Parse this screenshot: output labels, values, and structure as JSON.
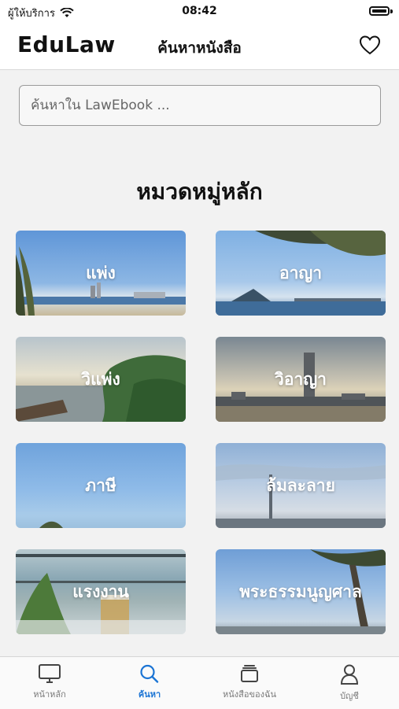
{
  "status_bar": {
    "carrier": "ผู้ให้บริการ",
    "time": "08:42"
  },
  "header": {
    "brand": "EduLaw",
    "title": "ค้นหาหนังสือ",
    "favorite_icon": "heart-icon"
  },
  "search": {
    "placeholder": "ค้นหาใน LawEbook ..."
  },
  "section_title": "หมวดหมู่หลัก",
  "categories": [
    {
      "label": "แพ่ง"
    },
    {
      "label": "อาญา"
    },
    {
      "label": "วิแพ่ง"
    },
    {
      "label": "วิอาญา"
    },
    {
      "label": "ภาษี"
    },
    {
      "label": "ล้มละลาย"
    },
    {
      "label": "แรงงาน"
    },
    {
      "label": "พระธรรมนูญศาล"
    }
  ],
  "tab_bar": {
    "items": [
      {
        "label": "หน้าหลัก",
        "icon": "monitor-icon",
        "active": false
      },
      {
        "label": "ค้นหา",
        "icon": "search-icon",
        "active": true
      },
      {
        "label": "หนังสือของฉัน",
        "icon": "books-icon",
        "active": false
      },
      {
        "label": "บัญชี",
        "icon": "person-icon",
        "active": false
      }
    ]
  },
  "colors": {
    "accent": "#1b74d4",
    "sky": "#6fa3dc"
  }
}
